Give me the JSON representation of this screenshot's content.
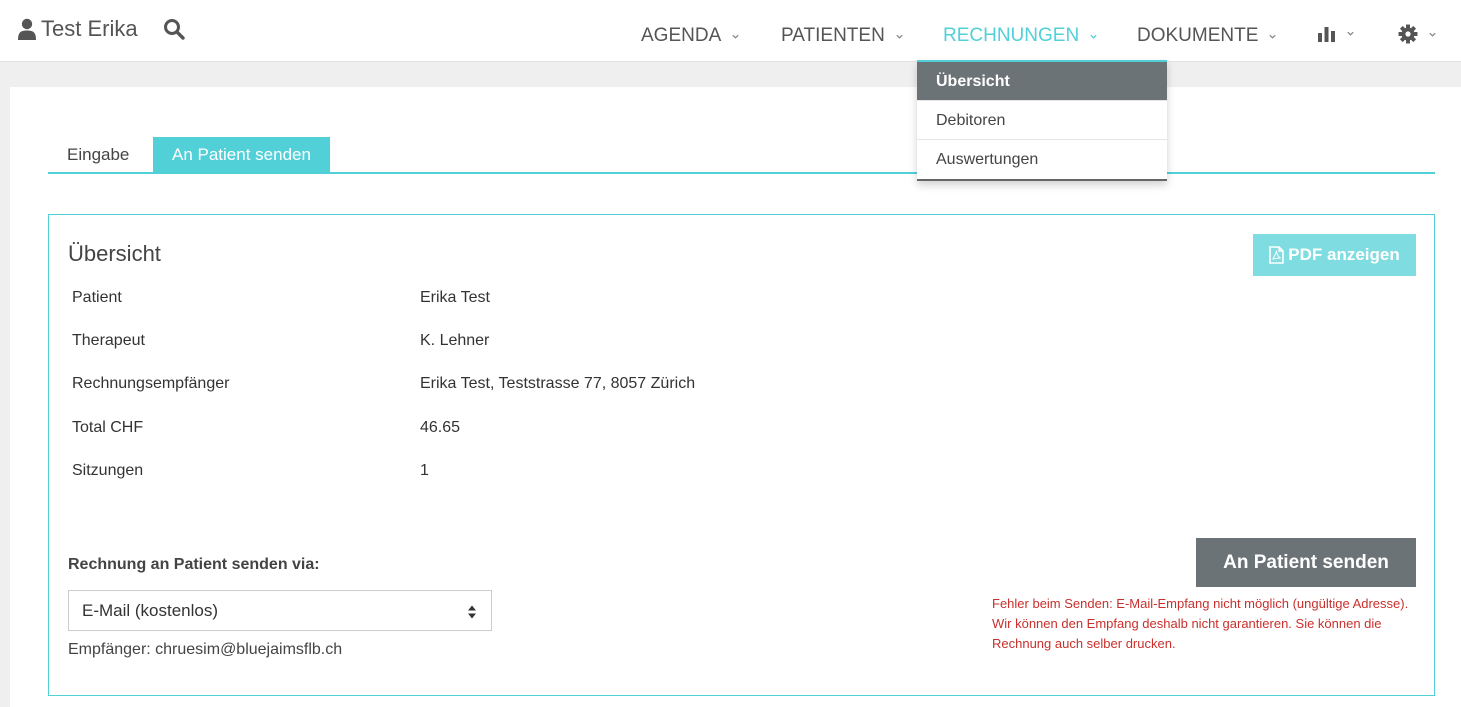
{
  "header": {
    "user_name": "Test Erika",
    "user_icon": "user-icon",
    "search_icon": "search-icon",
    "nav": [
      {
        "label": "AGENDA"
      },
      {
        "label": "PATIENTEN"
      },
      {
        "label": "RECHNUNGEN",
        "active": true
      },
      {
        "label": "DOKUMENTE"
      }
    ],
    "stats_icon": "bar-chart-icon",
    "settings_icon": "gear-icon",
    "accent_color": "#52d0d8"
  },
  "dropdown": {
    "items": [
      {
        "label": "Übersicht",
        "selected": true
      },
      {
        "label": "Debitoren"
      },
      {
        "label": "Auswertungen"
      }
    ]
  },
  "tabs": [
    {
      "label": "Eingabe"
    },
    {
      "label": "An Patient senden",
      "active": true
    }
  ],
  "overview": {
    "title": "Übersicht",
    "pdf_button": "PDF anzeigen",
    "rows": [
      {
        "label": "Patient",
        "value": "Erika Test"
      },
      {
        "label": "Therapeut",
        "value": "K. Lehner"
      },
      {
        "label": "Rechnungsempfänger",
        "value": "Erika Test, Teststrasse 77, 8057 Zürich"
      },
      {
        "label": "Total CHF",
        "value": "46.65"
      },
      {
        "label": "Sitzungen",
        "value": "1"
      }
    ]
  },
  "send": {
    "label": "Rechnung an Patient senden via:",
    "method": "E-Mail (kostenlos)",
    "recipient": "Empfänger: chruesim@bluejaimsflb.ch",
    "button": "An Patient senden",
    "error": "Fehler beim Senden: E-Mail-Empfang nicht möglich (ungültige Adresse). Wir können den Empfang deshalb nicht garantieren. Sie können die Rechnung auch selber drucken.",
    "error_color": "#c9302c"
  }
}
